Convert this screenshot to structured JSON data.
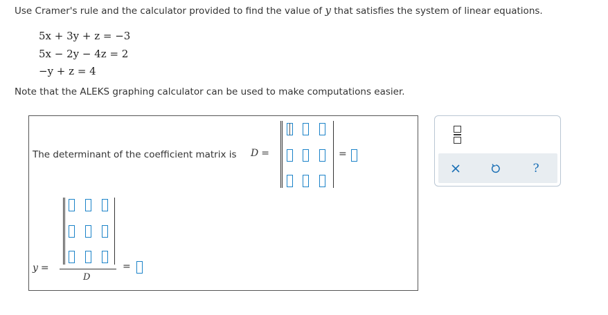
{
  "instruction": {
    "before": "Use Cramer's rule and the calculator provided to find the value of",
    "var": "y",
    "after": "that satisfies the system of linear equations."
  },
  "equations": [
    "5x + 3y + z = −3",
    "5x − 2y − 4z = 2",
    "−y + z = 4"
  ],
  "note": "Note that the ALEKS graphing calculator can be used to make computations easier.",
  "answer": {
    "det_label": "The determinant of the coefficient matrix is",
    "det_symbol": "D",
    "equals": "=",
    "y_symbol": "y",
    "denominator": "D"
  },
  "toolbar": {
    "icons": [
      "fraction-icon",
      "clear-icon",
      "undo-icon",
      "help-icon"
    ],
    "help_label": "?"
  },
  "colors": {
    "input_border": "#1a82c8",
    "toolbar_bg": "#e8edf1",
    "toolbar_icon": "#1a6fb5"
  }
}
